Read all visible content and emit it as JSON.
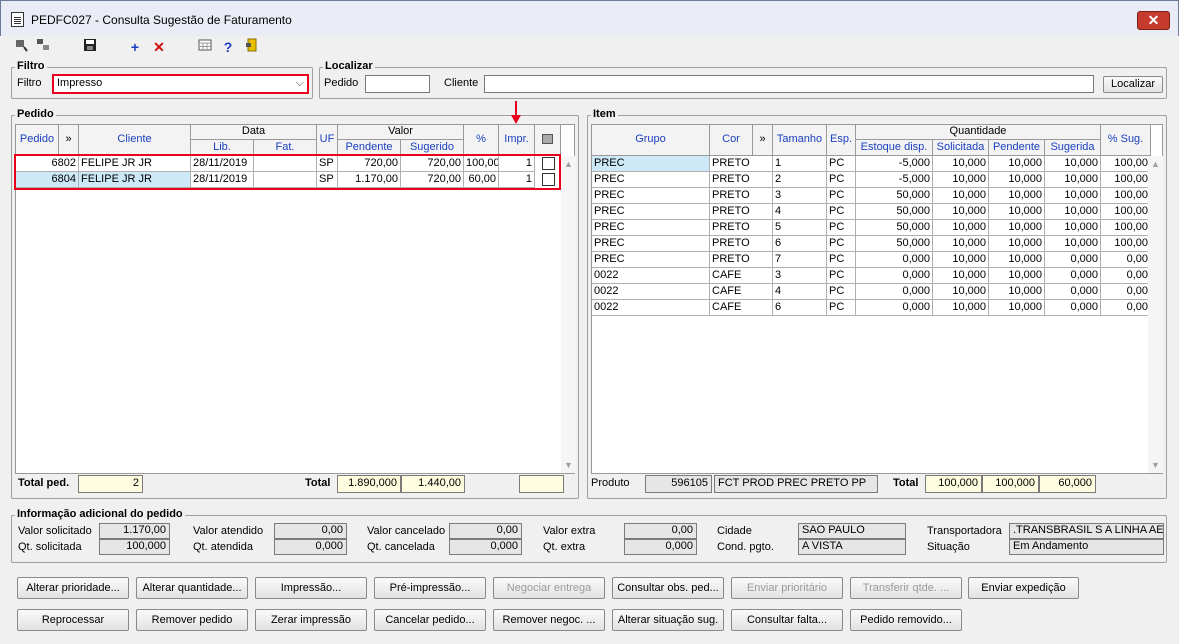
{
  "window": {
    "title": "PEDFC027 - Consulta Sugestão de Faturamento",
    "close": "✕"
  },
  "toolbar": {
    "save": "💾",
    "add": "+",
    "delete": "✕",
    "help": "?"
  },
  "filtro": {
    "legend": "Filtro",
    "label": "Filtro",
    "value": "Impresso",
    "arrow": "⌵"
  },
  "localizar": {
    "legend": "Localizar",
    "pedido_label": "Pedido",
    "pedido_value": "",
    "cliente_label": "Cliente",
    "cliente_value": "",
    "button": "Localizar"
  },
  "pedido": {
    "legend": "Pedido",
    "headers": {
      "pedido": "Pedido",
      "expand": "»",
      "cliente": "Cliente",
      "data": "Data",
      "lib": "Lib.",
      "fat": "Fat.",
      "uf": "UF",
      "valor": "Valor",
      "pendente": "Pendente",
      "sugerido": "Sugerido",
      "pct": "%",
      "impr": "Impr."
    },
    "rows": [
      {
        "pedido": "6802",
        "cliente": "FELIPE JR JR",
        "lib": "28/11/2019",
        "fat": "",
        "uf": "SP",
        "pendente": "720,00",
        "sugerido": "720,00",
        "pct": "100,00",
        "impr": "1"
      },
      {
        "pedido": "6804",
        "cliente": "FELIPE JR JR",
        "lib": "28/11/2019",
        "fat": "",
        "uf": "SP",
        "pendente": "1.170,00",
        "sugerido": "720,00",
        "pct": "60,00",
        "impr": "1"
      }
    ],
    "total_ped_label": "Total ped.",
    "total_ped": "2",
    "total_label": "Total",
    "total_pendente": "1.890,000",
    "total_sugerido": "1.440,00",
    "total_extra": ""
  },
  "item": {
    "legend": "Item",
    "headers": {
      "grupo": "Grupo",
      "cor": "Cor",
      "expand": "»",
      "tamanho": "Tamanho",
      "esp": "Esp.",
      "quantidade": "Quantidade",
      "estoque": "Estoque disp.",
      "solicitada": "Solicitada",
      "pendente": "Pendente",
      "sugerida": "Sugerida",
      "pct_sug": "% Sug."
    },
    "rows": [
      {
        "grupo": "PREC",
        "cor": "PRETO",
        "tam": "1",
        "esp": "PC",
        "estoque": "-5,000",
        "solicitada": "10,000",
        "pendente": "10,000",
        "sugerida": "10,000",
        "pct": "100,00"
      },
      {
        "grupo": "PREC",
        "cor": "PRETO",
        "tam": "2",
        "esp": "PC",
        "estoque": "-5,000",
        "solicitada": "10,000",
        "pendente": "10,000",
        "sugerida": "10,000",
        "pct": "100,00"
      },
      {
        "grupo": "PREC",
        "cor": "PRETO",
        "tam": "3",
        "esp": "PC",
        "estoque": "50,000",
        "solicitada": "10,000",
        "pendente": "10,000",
        "sugerida": "10,000",
        "pct": "100,00"
      },
      {
        "grupo": "PREC",
        "cor": "PRETO",
        "tam": "4",
        "esp": "PC",
        "estoque": "50,000",
        "solicitada": "10,000",
        "pendente": "10,000",
        "sugerida": "10,000",
        "pct": "100,00"
      },
      {
        "grupo": "PREC",
        "cor": "PRETO",
        "tam": "5",
        "esp": "PC",
        "estoque": "50,000",
        "solicitada": "10,000",
        "pendente": "10,000",
        "sugerida": "10,000",
        "pct": "100,00"
      },
      {
        "grupo": "PREC",
        "cor": "PRETO",
        "tam": "6",
        "esp": "PC",
        "estoque": "50,000",
        "solicitada": "10,000",
        "pendente": "10,000",
        "sugerida": "10,000",
        "pct": "100,00"
      },
      {
        "grupo": "PREC",
        "cor": "PRETO",
        "tam": "7",
        "esp": "PC",
        "estoque": "0,000",
        "solicitada": "10,000",
        "pendente": "10,000",
        "sugerida": "0,000",
        "pct": "0,00"
      },
      {
        "grupo": "0022",
        "cor": "CAFE",
        "tam": "3",
        "esp": "PC",
        "estoque": "0,000",
        "solicitada": "10,000",
        "pendente": "10,000",
        "sugerida": "0,000",
        "pct": "0,00"
      },
      {
        "grupo": "0022",
        "cor": "CAFE",
        "tam": "4",
        "esp": "PC",
        "estoque": "0,000",
        "solicitada": "10,000",
        "pendente": "10,000",
        "sugerida": "0,000",
        "pct": "0,00"
      },
      {
        "grupo": "0022",
        "cor": "CAFE",
        "tam": "6",
        "esp": "PC",
        "estoque": "0,000",
        "solicitada": "10,000",
        "pendente": "10,000",
        "sugerida": "0,000",
        "pct": "0,00"
      }
    ],
    "produto_label": "Produto",
    "produto_code": "596105",
    "produto_desc": "FCT PROD PREC PRETO PP",
    "total_label": "Total",
    "total_solicitada": "100,000",
    "total_pendente": "100,000",
    "total_sugerida": "60,000"
  },
  "info": {
    "legend": "Informação adicional do pedido",
    "valor_solicitado_label": "Valor solicitado",
    "valor_solicitado": "1.170,00",
    "qt_solicitada_label": "Qt. solicitada",
    "qt_solicitada": "100,000",
    "valor_atendido_label": "Valor atendido",
    "valor_atendido": "0,00",
    "qt_atendida_label": "Qt. atendida",
    "qt_atendida": "0,000",
    "valor_cancelado_label": "Valor cancelado",
    "valor_cancelado": "0,00",
    "qt_cancelada_label": "Qt. cancelada",
    "qt_cancelada": "0,000",
    "valor_extra_label": "Valor extra",
    "valor_extra": "0,00",
    "qt_extra_label": "Qt. extra",
    "qt_extra": "0,000",
    "cidade_label": "Cidade",
    "cidade": "SAO PAULO",
    "cond_pgto_label": "Cond. pgto.",
    "cond_pgto": "A VISTA",
    "transportadora_label": "Transportadora",
    "transportadora": ".TRANSBRASIL S A LINHA AERI",
    "situacao_label": "Situação",
    "situacao": "Em Andamento"
  },
  "buttons": {
    "alterar_prioridade": "Alterar prioridade...",
    "alterar_quantidade": "Alterar quantidade...",
    "impressao": "Impressão...",
    "pre_impressao": "Pré-impressão...",
    "negociar_entrega": "Negociar entrega",
    "consultar_obs": "Consultar obs. ped...",
    "enviar_prioritario": "Enviar prioritário",
    "transferir_qtde": "Transferir qtde. ...",
    "enviar_expedicao": "Enviar expedição",
    "reprocessar": "Reprocessar",
    "remover_pedido": "Remover pedido",
    "zerar_impressao": "Zerar impressão",
    "cancelar_pedido": "Cancelar pedido...",
    "remover_negoc": "Remover negoc. ...",
    "alterar_situacao": "Alterar situação sug.",
    "consultar_falta": "Consultar falta...",
    "pedido_removido": "Pedido removido..."
  },
  "colors": {
    "highlight": "#e8001c",
    "selected_row": "#cde8f7",
    "header_text": "#1a3fbf"
  }
}
